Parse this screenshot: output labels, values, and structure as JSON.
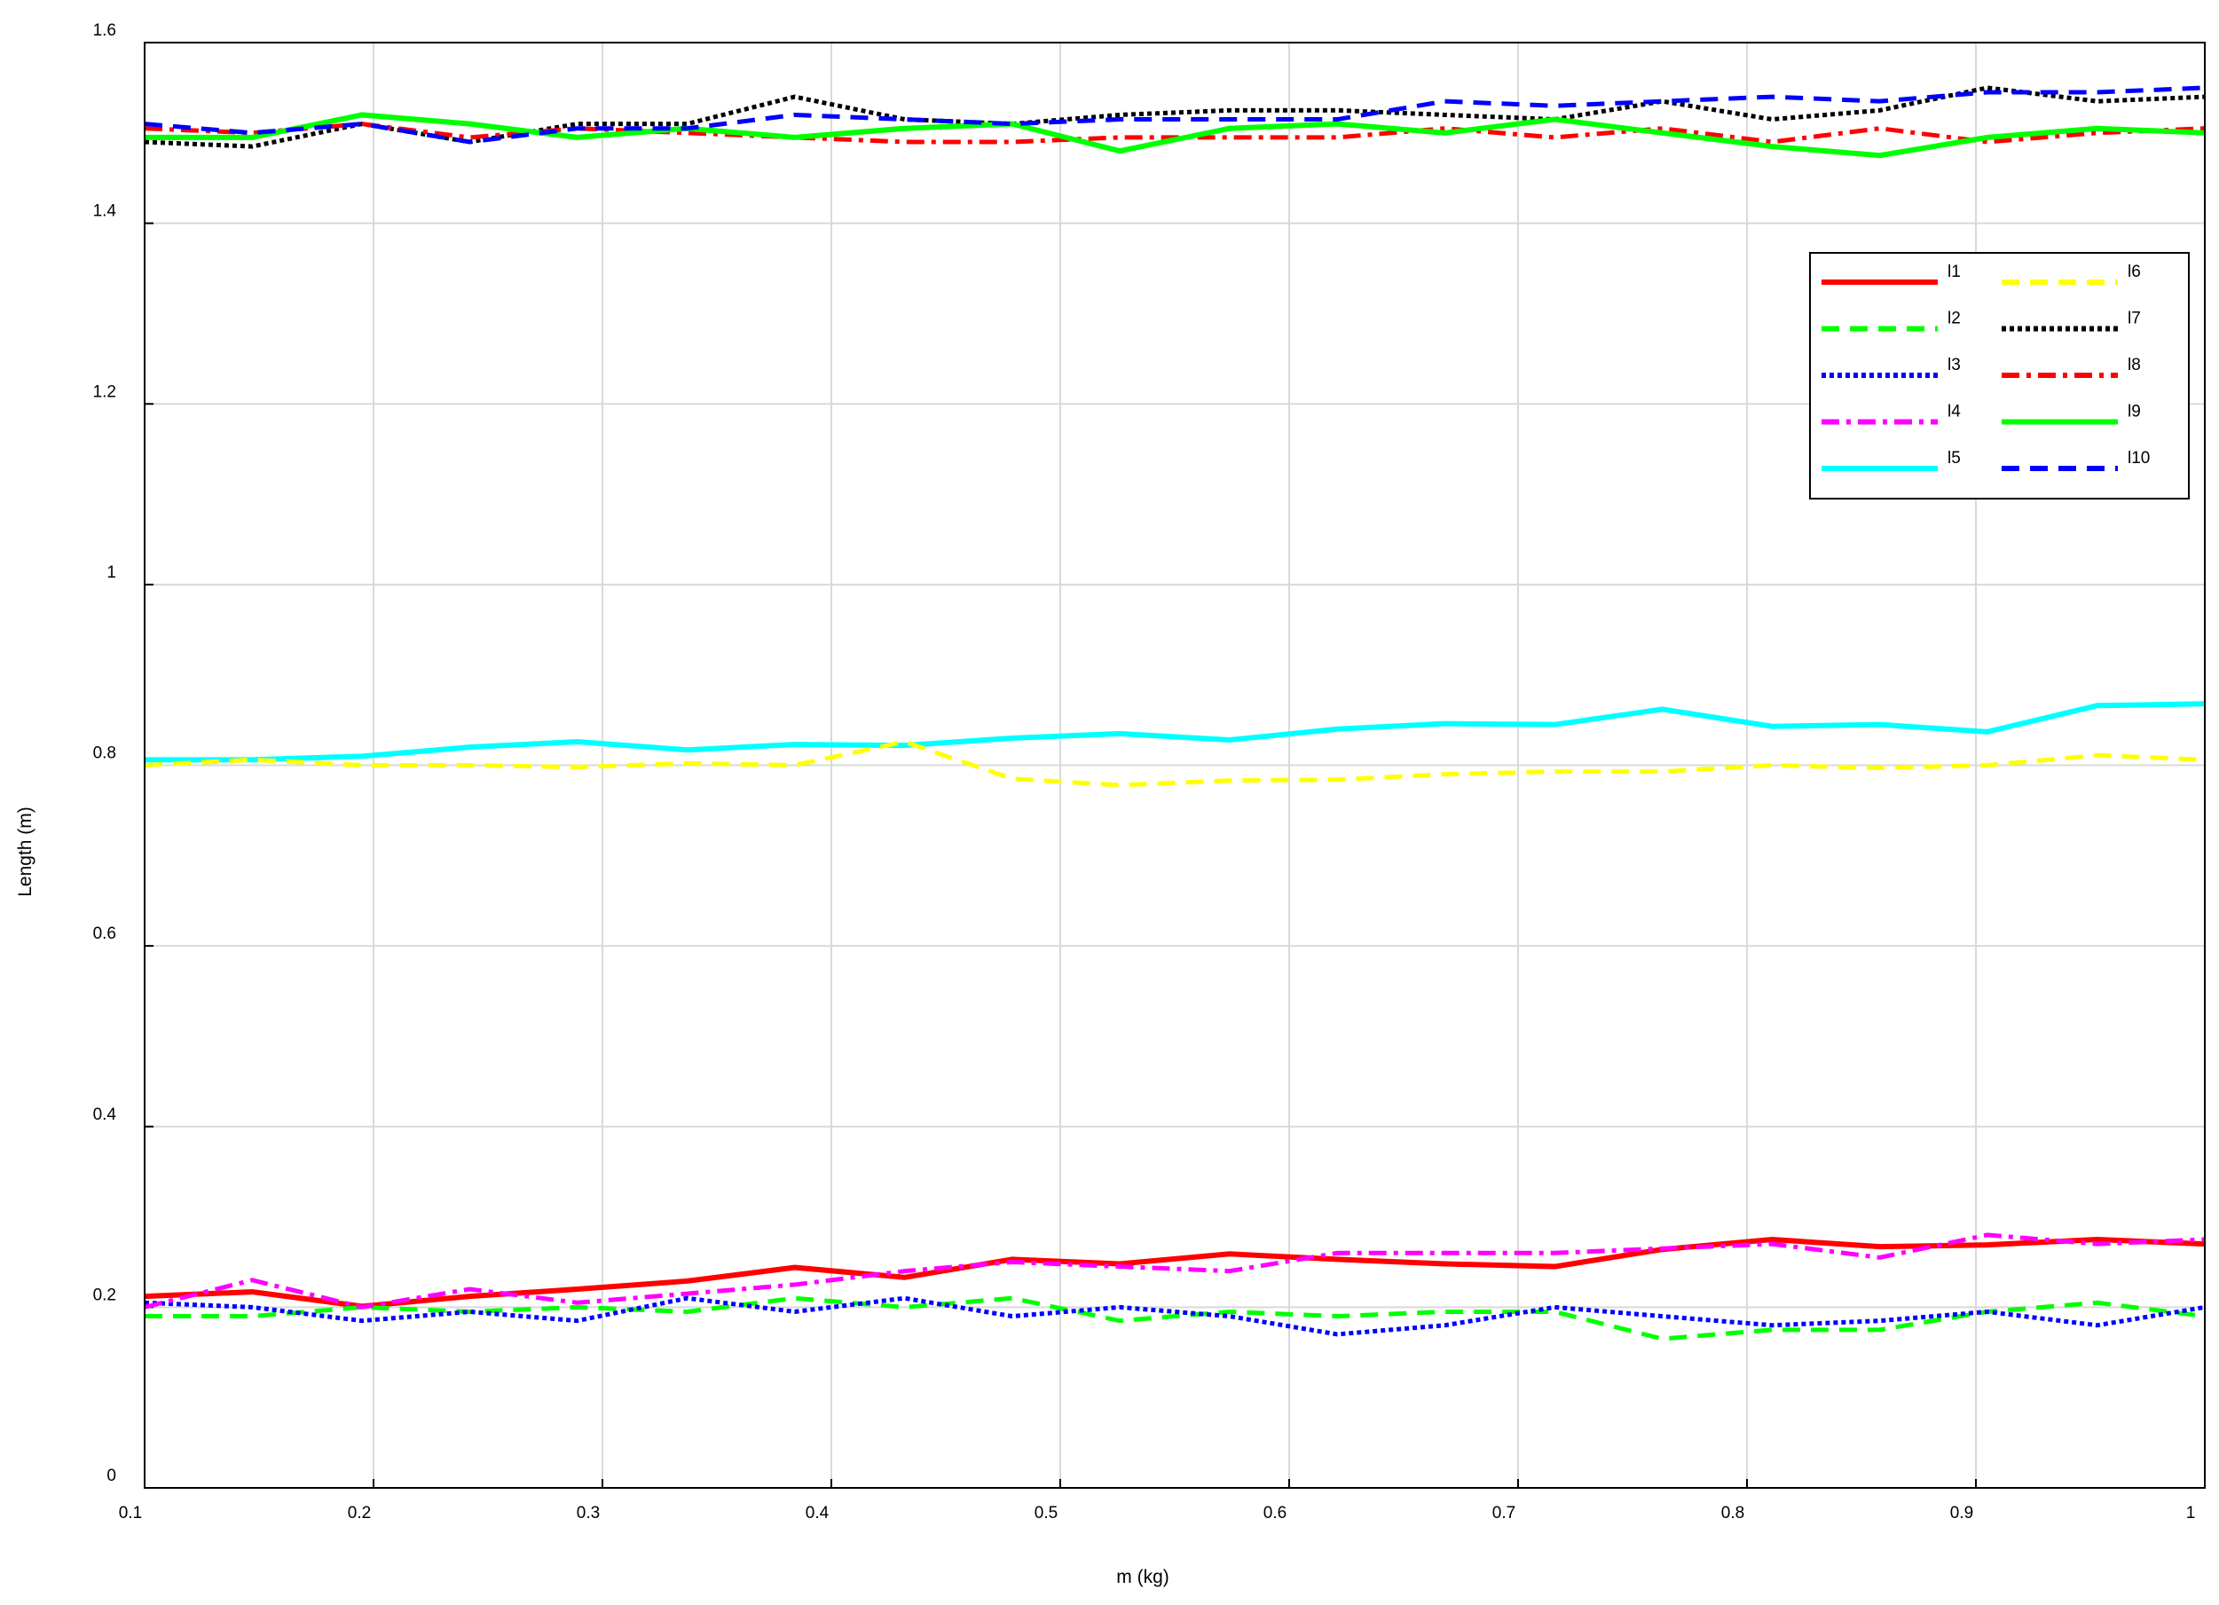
{
  "chart_data": {
    "type": "line",
    "title": "",
    "xlabel": "m (kg)",
    "ylabel": "Length (m)",
    "xlim": [
      0.1,
      1
    ],
    "ylim": [
      0,
      1.6
    ],
    "grid": true,
    "legend_placement": "top-right",
    "xticks": [
      "0.1",
      "0.2",
      "0.3",
      "0.4",
      "0.5",
      "0.6",
      "0.7",
      "0.8",
      "0.9",
      "1"
    ],
    "yticks": [
      "0",
      "0.2",
      "0.4",
      "0.6",
      "0.8",
      "1",
      "1.2",
      "1.4",
      "1.6"
    ],
    "x": [
      0.1,
      0.147,
      0.195,
      0.242,
      0.289,
      0.337,
      0.384,
      0.432,
      0.479,
      0.526,
      0.574,
      0.621,
      0.668,
      0.716,
      0.763,
      0.811,
      0.858,
      0.905,
      0.953,
      1.0
    ],
    "series": [
      {
        "name": "l1",
        "color": "#ff0000",
        "style": "solid",
        "values": [
          0.212,
          0.217,
          0.201,
          0.212,
          0.22,
          0.229,
          0.244,
          0.233,
          0.253,
          0.248,
          0.259,
          0.253,
          0.248,
          0.245,
          0.264,
          0.275,
          0.267,
          0.269,
          0.275,
          0.27
        ]
      },
      {
        "name": "l2",
        "color": "#00ff00",
        "style": "dashed",
        "values": [
          0.19,
          0.19,
          0.2,
          0.195,
          0.2,
          0.195,
          0.21,
          0.2,
          0.21,
          0.185,
          0.195,
          0.19,
          0.195,
          0.195,
          0.165,
          0.175,
          0.175,
          0.195,
          0.205,
          0.19
        ]
      },
      {
        "name": "l3",
        "color": "#0000ff",
        "style": "dotted",
        "values": [
          0.205,
          0.2,
          0.185,
          0.195,
          0.185,
          0.21,
          0.195,
          0.21,
          0.19,
          0.2,
          0.19,
          0.17,
          0.18,
          0.2,
          0.19,
          0.18,
          0.185,
          0.195,
          0.18,
          0.2
        ]
      },
      {
        "name": "l4",
        "color": "#ff00ff",
        "style": "dashdot",
        "values": [
          0.2,
          0.23,
          0.2,
          0.22,
          0.205,
          0.215,
          0.225,
          0.24,
          0.25,
          0.245,
          0.24,
          0.26,
          0.26,
          0.26,
          0.265,
          0.27,
          0.255,
          0.28,
          0.27,
          0.275
        ]
      },
      {
        "name": "l5",
        "color": "#00ffff",
        "style": "solid",
        "values": [
          0.806,
          0.806,
          0.81,
          0.82,
          0.826,
          0.817,
          0.823,
          0.822,
          0.83,
          0.835,
          0.828,
          0.84,
          0.846,
          0.845,
          0.862,
          0.843,
          0.845,
          0.837,
          0.866,
          0.868
        ]
      },
      {
        "name": "l6",
        "color": "#ffff00",
        "style": "dashed",
        "values": [
          0.8,
          0.806,
          0.8,
          0.8,
          0.798,
          0.802,
          0.8,
          0.826,
          0.785,
          0.778,
          0.783,
          0.784,
          0.79,
          0.793,
          0.793,
          0.8,
          0.797,
          0.8,
          0.811,
          0.806
        ]
      },
      {
        "name": "l7",
        "color": "#000000",
        "style": "dotted",
        "values": [
          1.49,
          1.485,
          1.51,
          1.49,
          1.51,
          1.51,
          1.54,
          1.515,
          1.51,
          1.52,
          1.525,
          1.525,
          1.52,
          1.515,
          1.535,
          1.515,
          1.525,
          1.55,
          1.535,
          1.54
        ]
      },
      {
        "name": "l8",
        "color": "#ff0000",
        "style": "dashdot",
        "values": [
          1.505,
          1.5,
          1.51,
          1.495,
          1.505,
          1.5,
          1.495,
          1.49,
          1.49,
          1.495,
          1.495,
          1.495,
          1.505,
          1.495,
          1.505,
          1.49,
          1.505,
          1.49,
          1.5,
          1.505
        ]
      },
      {
        "name": "l9",
        "color": "#00ff00",
        "style": "solid",
        "values": [
          1.495,
          1.495,
          1.52,
          1.51,
          1.495,
          1.505,
          1.495,
          1.505,
          1.51,
          1.48,
          1.505,
          1.51,
          1.5,
          1.515,
          1.5,
          1.485,
          1.475,
          1.495,
          1.505,
          1.5
        ]
      },
      {
        "name": "l10",
        "color": "#0000ff",
        "style": "dashed",
        "values": [
          1.51,
          1.5,
          1.51,
          1.49,
          1.505,
          1.505,
          1.52,
          1.515,
          1.51,
          1.515,
          1.515,
          1.515,
          1.535,
          1.53,
          1.535,
          1.54,
          1.535,
          1.545,
          1.545,
          1.55
        ]
      }
    ]
  }
}
